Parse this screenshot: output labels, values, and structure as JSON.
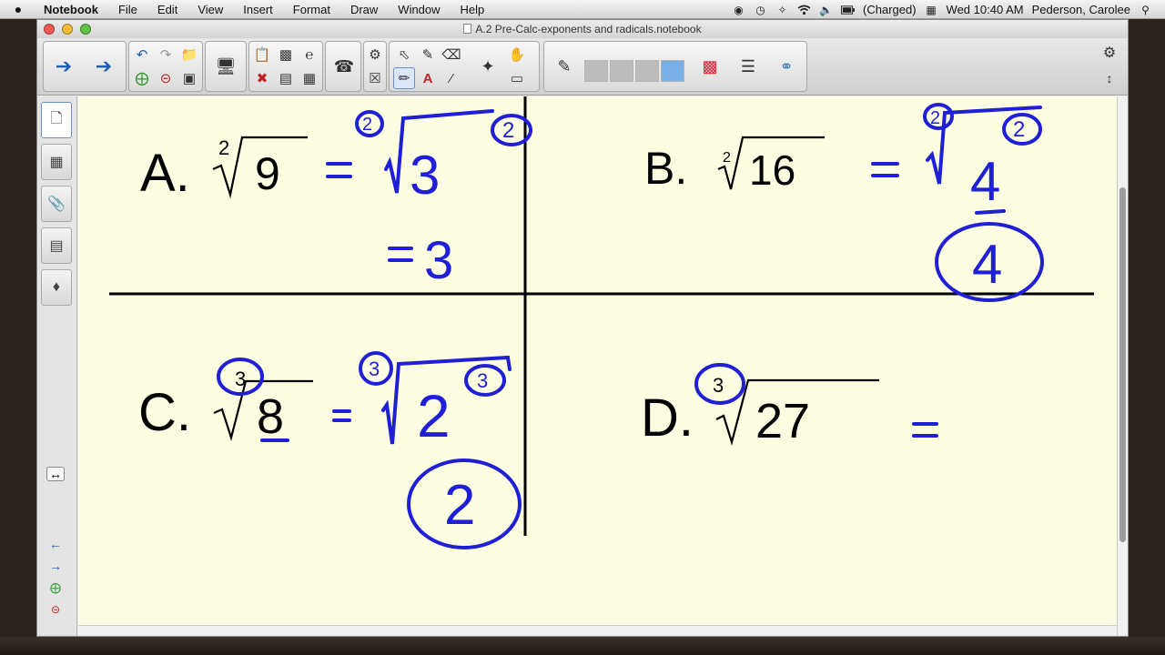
{
  "menubar": {
    "app": "Notebook",
    "menus": [
      "File",
      "Edit",
      "View",
      "Insert",
      "Format",
      "Draw",
      "Window",
      "Help"
    ],
    "battery": "(Charged)",
    "clock": "Wed 10:40 AM",
    "user": "Pederson, Carolee"
  },
  "window": {
    "title": "A.2 Pre-Calc-exponents and radicals.notebook"
  },
  "problems": {
    "a": {
      "letter": "A.",
      "index": "2",
      "radicand": "9",
      "work_index": "2",
      "work_base": "3",
      "work_exp": "2",
      "result": "3"
    },
    "b": {
      "letter": "B.",
      "index": "2",
      "radicand": "16",
      "work_index": "2",
      "work_base": "4",
      "work_exp": "2",
      "result": "4"
    },
    "c": {
      "letter": "C.",
      "index": "3",
      "radicand": "8",
      "work_index": "3",
      "work_base": "2",
      "work_exp": "3",
      "result": "2"
    },
    "d": {
      "letter": "D.",
      "index": "3",
      "radicand": "27"
    }
  },
  "colors": {
    "ink": "#1f1fd6",
    "paper": "#fdfde2"
  }
}
